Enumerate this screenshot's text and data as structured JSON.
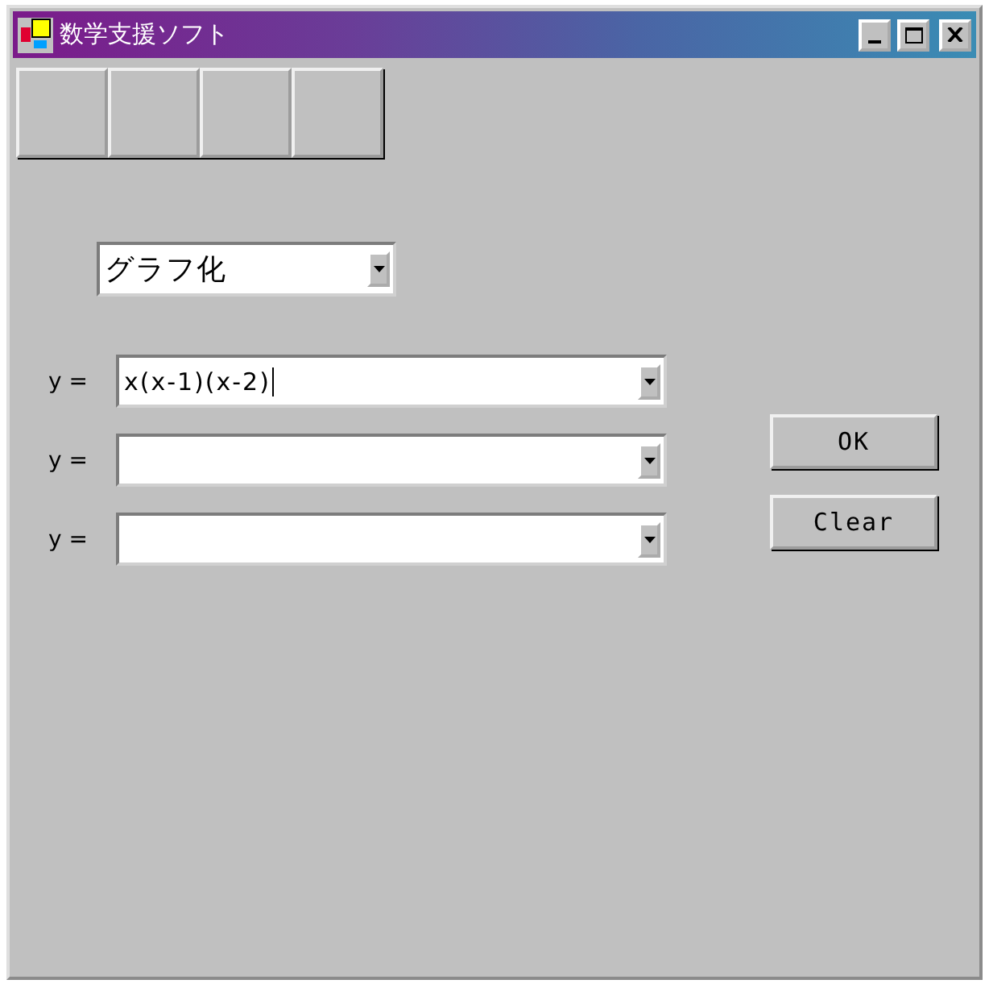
{
  "window": {
    "title": "数学支援ソフト"
  },
  "mode_select": {
    "value": "グラフ化"
  },
  "equations": [
    {
      "label": "y =",
      "value": "x(x-1)(x-2)",
      "focused": true
    },
    {
      "label": "y =",
      "focused": false
    },
    {
      "label": "y =",
      "focused": false
    }
  ],
  "buttons": [
    "OK",
    "Clear"
  ]
}
